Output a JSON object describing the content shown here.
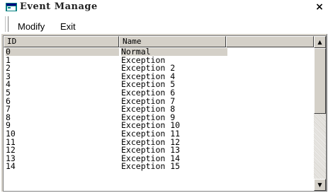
{
  "window": {
    "title": "Event Manage",
    "close_glyph": "×",
    "icon": "app-window-icon"
  },
  "menu": {
    "modify_label": "Modify",
    "exit_label": "Exit"
  },
  "list": {
    "columns": [
      "ID",
      "Name"
    ],
    "selected_index": 0,
    "rows": [
      {
        "id": "0",
        "name": "Normal"
      },
      {
        "id": "1",
        "name": "Exception"
      },
      {
        "id": "2",
        "name": "Exception 2"
      },
      {
        "id": "3",
        "name": "Exception 4"
      },
      {
        "id": "4",
        "name": "Exception 5"
      },
      {
        "id": "5",
        "name": "Exception 6"
      },
      {
        "id": "6",
        "name": "Exception 7"
      },
      {
        "id": "7",
        "name": "Exception 8"
      },
      {
        "id": "8",
        "name": "Exception 9"
      },
      {
        "id": "9",
        "name": "Exception 10"
      },
      {
        "id": "10",
        "name": "Exception 11"
      },
      {
        "id": "11",
        "name": "Exception 12"
      },
      {
        "id": "12",
        "name": "Exception 13"
      },
      {
        "id": "13",
        "name": "Exception 14"
      },
      {
        "id": "14",
        "name": "Exception 15"
      }
    ]
  },
  "scrollbar": {
    "up_glyph": "▲",
    "down_glyph": "▼"
  }
}
